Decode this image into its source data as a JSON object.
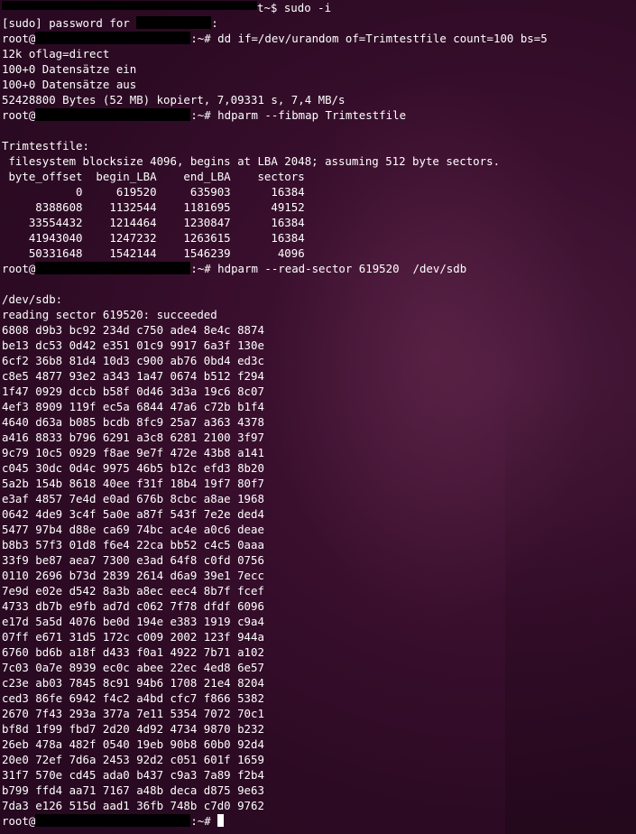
{
  "terminal": {
    "lines": [
      {
        "type": "redact-head",
        "after": "t~$ sudo -i"
      },
      {
        "type": "redact-mid",
        "before": "[sudo] password for ",
        "after": ":"
      },
      {
        "type": "prompt",
        "before": "root@",
        "after": ":~# dd if=/dev/urandom of=Trimtestfile count=100 bs=5"
      },
      {
        "type": "text",
        "text": "12k oflag=direct"
      },
      {
        "type": "text",
        "text": "100+0 Datensätze ein"
      },
      {
        "type": "text",
        "text": "100+0 Datensätze aus"
      },
      {
        "type": "text",
        "text": "52428800 Bytes (52 MB) kopiert, 7,09331 s, 7,4 MB/s"
      },
      {
        "type": "prompt",
        "before": "root@",
        "after": ":~# hdparm --fibmap Trimtestfile"
      },
      {
        "type": "text",
        "text": ""
      },
      {
        "type": "text",
        "text": "Trimtestfile:"
      },
      {
        "type": "text",
        "text": " filesystem blocksize 4096, begins at LBA 2048; assuming 512 byte sectors."
      },
      {
        "type": "text",
        "text": " byte_offset  begin_LBA    end_LBA    sectors"
      },
      {
        "type": "text",
        "text": "           0     619520     635903      16384"
      },
      {
        "type": "text",
        "text": "     8388608    1132544    1181695      49152"
      },
      {
        "type": "text",
        "text": "    33554432    1214464    1230847      16384"
      },
      {
        "type": "text",
        "text": "    41943040    1247232    1263615      16384"
      },
      {
        "type": "text",
        "text": "    50331648    1542144    1546239       4096"
      },
      {
        "type": "prompt",
        "before": "root@",
        "after": ":~# hdparm --read-sector 619520  /dev/sdb"
      },
      {
        "type": "text",
        "text": ""
      },
      {
        "type": "text",
        "text": "/dev/sdb:"
      },
      {
        "type": "text",
        "text": "reading sector 619520: succeeded"
      },
      {
        "type": "text",
        "text": "6808 d9b3 bc92 234d c750 ade4 8e4c 8874"
      },
      {
        "type": "text",
        "text": "be13 dc53 0d42 e351 01c9 9917 6a3f 130e"
      },
      {
        "type": "text",
        "text": "6cf2 36b8 81d4 10d3 c900 ab76 0bd4 ed3c"
      },
      {
        "type": "text",
        "text": "c8e5 4877 93e2 a343 1a47 0674 b512 f294"
      },
      {
        "type": "text",
        "text": "1f47 0929 dccb b58f 0d46 3d3a 19c6 8c07"
      },
      {
        "type": "text",
        "text": "4ef3 8909 119f ec5a 6844 47a6 c72b b1f4"
      },
      {
        "type": "text",
        "text": "4640 d63a b085 bcdb 8fc9 25a7 a363 4378"
      },
      {
        "type": "text",
        "text": "a416 8833 b796 6291 a3c8 6281 2100 3f97"
      },
      {
        "type": "text",
        "text": "9c79 10c5 0929 f8ae 9e7f 472e 43b8 a141"
      },
      {
        "type": "text",
        "text": "c045 30dc 0d4c 9975 46b5 b12c efd3 8b20"
      },
      {
        "type": "text",
        "text": "5a2b 154b 8618 40ee f31f 18b4 19f7 80f7"
      },
      {
        "type": "text",
        "text": "e3af 4857 7e4d e0ad 676b 8cbc a8ae 1968"
      },
      {
        "type": "text",
        "text": "0642 4de9 3c4f 5a0e a87f 543f 7e2e ded4"
      },
      {
        "type": "text",
        "text": "5477 97b4 d88e ca69 74bc ac4e a0c6 deae"
      },
      {
        "type": "text",
        "text": "b8b3 57f3 01d8 f6e4 22ca bb52 c4c5 0aaa"
      },
      {
        "type": "text",
        "text": "33f9 be87 aea7 7300 e3ad 64f8 c0fd 0756"
      },
      {
        "type": "text",
        "text": "0110 2696 b73d 2839 2614 d6a9 39e1 7ecc"
      },
      {
        "type": "text",
        "text": "7e9d e02e d542 8a3b a8ec eec4 8b7f fcef"
      },
      {
        "type": "text",
        "text": "4733 db7b e9fb ad7d c062 7f78 dfdf 6096"
      },
      {
        "type": "text",
        "text": "e17d 5a5d 4076 be0d 194e e383 1919 c9a4"
      },
      {
        "type": "text",
        "text": "07ff e671 31d5 172c c009 2002 123f 944a"
      },
      {
        "type": "text",
        "text": "6760 bd6b a18f d433 f0a1 4922 7b71 a102"
      },
      {
        "type": "text",
        "text": "7c03 0a7e 8939 ec0c abee 22ec 4ed8 6e57"
      },
      {
        "type": "text",
        "text": "c23e ab03 7845 8c91 94b6 1708 21e4 8204"
      },
      {
        "type": "text",
        "text": "ced3 86fe 6942 f4c2 a4bd cfc7 f866 5382"
      },
      {
        "type": "text",
        "text": "2670 7f43 293a 377a 7e11 5354 7072 70c1"
      },
      {
        "type": "text",
        "text": "bf8d 1f99 fbd7 2d20 4d92 4734 9870 b232"
      },
      {
        "type": "text",
        "text": "26eb 478a 482f 0540 19eb 90b8 60b0 92d4"
      },
      {
        "type": "text",
        "text": "20e0 72ef 7d6a 2453 92d2 c051 601f 1659"
      },
      {
        "type": "text",
        "text": "31f7 570e cd45 ada0 b437 c9a3 7a89 f2b4"
      },
      {
        "type": "text",
        "text": "b799 ffd4 aa71 7167 a48b deca d875 9e63"
      },
      {
        "type": "text",
        "text": "7da3 e126 515d aad1 36fb 748b c7d0 9762"
      },
      {
        "type": "prompt-cursor",
        "before": "root@",
        "after": ":~# "
      }
    ]
  }
}
